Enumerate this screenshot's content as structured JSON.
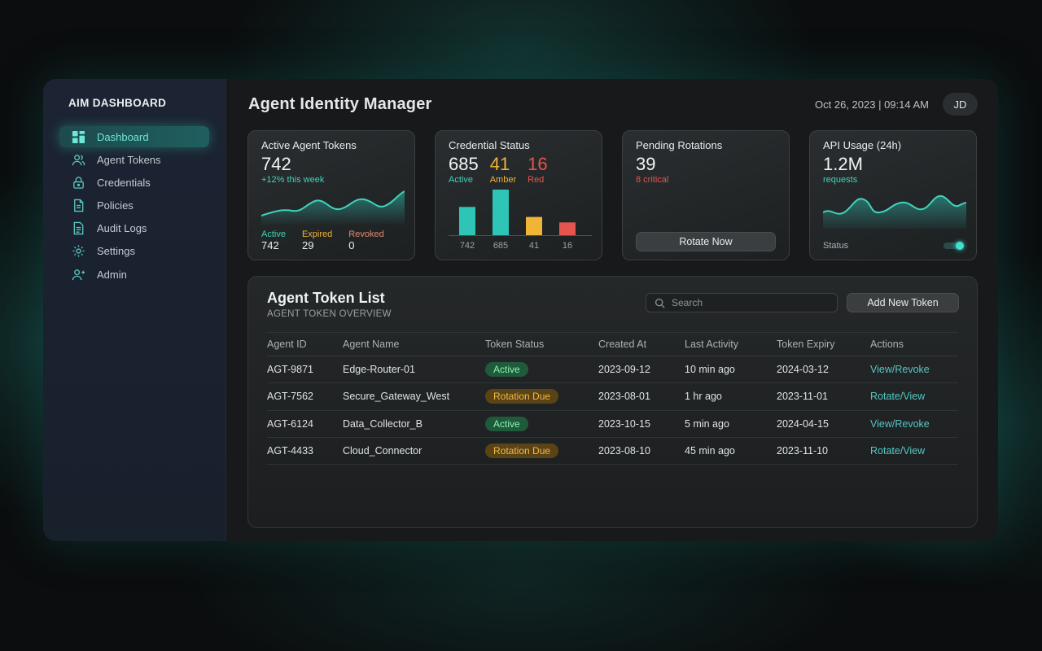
{
  "brand": "AIM DASHBOARD",
  "nav": [
    {
      "label": "Dashboard",
      "icon": "grid-icon",
      "active": true
    },
    {
      "label": "Agent Tokens",
      "icon": "users-icon"
    },
    {
      "label": "Credentials",
      "icon": "lock-icon"
    },
    {
      "label": "Policies",
      "icon": "document-icon"
    },
    {
      "label": "Audit Logs",
      "icon": "file-icon"
    },
    {
      "label": "Settings",
      "icon": "gear-icon"
    },
    {
      "label": "Admin",
      "icon": "admin-icon"
    }
  ],
  "header": {
    "title": "Agent Identity Manager",
    "datetime": "Oct 26, 2023 | 09:14 AM",
    "avatar": "JD"
  },
  "cards": {
    "tokens": {
      "title": "Active Agent Tokens",
      "value": "742",
      "delta": "+12% this week",
      "stats": [
        {
          "label": "Active",
          "value": "742",
          "color": "#3fd3ba"
        },
        {
          "label": "Expired",
          "value": "29",
          "color": "#f0b437"
        },
        {
          "label": "Revoked",
          "value": "0",
          "color": "#e08a6e"
        }
      ]
    },
    "credentials": {
      "title": "Credential Status",
      "counts": [
        {
          "value": "685",
          "label": "Active",
          "color": "#3fd3ba"
        },
        {
          "value": "41",
          "label": "Amber",
          "color": "#f0b437"
        },
        {
          "value": "16",
          "label": "Red",
          "color": "#e5544d"
        }
      ]
    },
    "rotations": {
      "title": "Pending Rotations",
      "value": "39",
      "sub": "8 critical",
      "button": "Rotate Now"
    },
    "api": {
      "title": "API Usage (24h)",
      "value": "1.2M",
      "sub": "requests",
      "status_label": "Status",
      "status_on": true
    }
  },
  "chart_data": {
    "type": "bar",
    "categories": [
      "742",
      "685",
      "41",
      "16"
    ],
    "values": [
      742,
      685,
      41,
      16
    ],
    "colors": [
      "#2ec4b6",
      "#2ec4b6",
      "#f0b437",
      "#e5544d"
    ],
    "bar_heights_relative": [
      0.62,
      1.0,
      0.4,
      0.28
    ]
  },
  "panel": {
    "title": "Agent Token List",
    "subtitle": "AGENT TOKEN OVERVIEW",
    "search_placeholder": "Search",
    "add_button": "Add New Token",
    "columns": [
      "Agent ID",
      "Agent Name",
      "Token Status",
      "Created At",
      "Last Activity",
      "Token Expiry",
      "Actions"
    ],
    "rows": [
      {
        "id": "AGT-9871",
        "name": "Edge-Router-01",
        "status": "Active",
        "kind": "active",
        "created": "2023-09-12",
        "activity": "10 min ago",
        "expiry": "2024-03-12",
        "actions": "View/Revoke"
      },
      {
        "id": "AGT-7562",
        "name": "Secure_Gateway_West",
        "status": "Rotation Due",
        "kind": "due",
        "created": "2023-08-01",
        "activity": "1 hr ago",
        "expiry": "2023-11-01",
        "actions": "Rotate/View"
      },
      {
        "id": "AGT-6124",
        "name": "Data_Collector_B",
        "status": "Active",
        "kind": "active",
        "created": "2023-10-15",
        "activity": "5 min ago",
        "expiry": "2024-04-15",
        "actions": "View/Revoke"
      },
      {
        "id": "AGT-4433",
        "name": "Cloud_Connector",
        "status": "Rotation Due",
        "kind": "due",
        "created": "2023-08-10",
        "activity": "45 min ago",
        "expiry": "2023-11-10",
        "actions": "Rotate/View"
      }
    ]
  }
}
